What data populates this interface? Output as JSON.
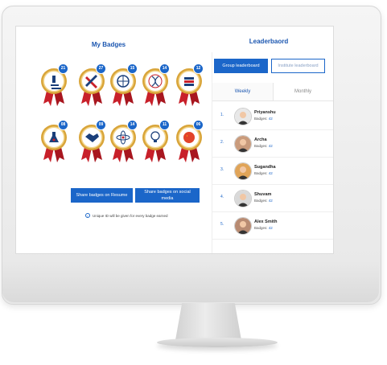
{
  "my_badges": {
    "title": "My Badges",
    "badges": [
      {
        "count": "21",
        "icon": "microscope-icon"
      },
      {
        "count": "27",
        "icon": "pencil-ruler-icon"
      },
      {
        "count": "15",
        "icon": "globe-icon"
      },
      {
        "count": "14",
        "icon": "dna-icon"
      },
      {
        "count": "12",
        "icon": "books-icon"
      },
      {
        "count": "08",
        "icon": "flask-icon"
      },
      {
        "count": "09",
        "icon": "handshake-icon"
      },
      {
        "count": "14",
        "icon": "atom-icon"
      },
      {
        "count": "11",
        "icon": "lightbulb-icon"
      },
      {
        "count": "06",
        "icon": "flag-icon"
      }
    ],
    "share_resume": "Share badges on Resume",
    "share_social": "Share badges on social media",
    "info": "Unique ID will be given for every badge earned"
  },
  "leaderboard": {
    "title": "Leaderbaord",
    "group_tab": "Group leaderboard",
    "institute_tab": "Institute leaderboard",
    "weekly": "Weekly",
    "monthly": "Monthly",
    "badges_label": "Badges:",
    "entries": [
      {
        "rank": "1.",
        "name": "Priyanshu",
        "badges": "42"
      },
      {
        "rank": "2.",
        "name": "Archa",
        "badges": "42"
      },
      {
        "rank": "3.",
        "name": "Sugandha",
        "badges": "42"
      },
      {
        "rank": "4.",
        "name": "Shuvam",
        "badges": "42"
      },
      {
        "rank": "5.",
        "name": "Alex Smith",
        "badges": "42"
      }
    ]
  },
  "colors": {
    "primary": "#1b66c9",
    "gold": "#d9a53a",
    "ribbon": "#c8202a"
  }
}
